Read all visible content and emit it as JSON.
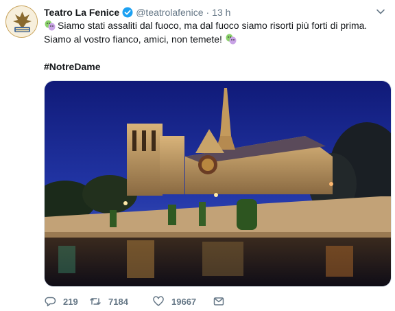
{
  "account": {
    "display_name": "Teatro La Fenice",
    "handle": "@teatrolafenice",
    "separator": "·",
    "time": "13 h"
  },
  "tweet": {
    "line1": "Siamo stati assaliti dal fuoco, ma dal fuoco siamo risorti più forti di prima.",
    "line2": "Siamo al vostro fianco, amici, non temete!",
    "hashtag": "#NotreDame",
    "emoji": "theater-masks-emoji"
  },
  "photo": {
    "subject": "notre-dame-cathedral-at-night"
  },
  "actions": {
    "reply_count": "219",
    "retweet_count": "7184",
    "like_count": "19667"
  },
  "colors": {
    "text": "#14171a",
    "secondary": "#657786",
    "verified": "#1da1f2",
    "sky": "#1a237e"
  }
}
